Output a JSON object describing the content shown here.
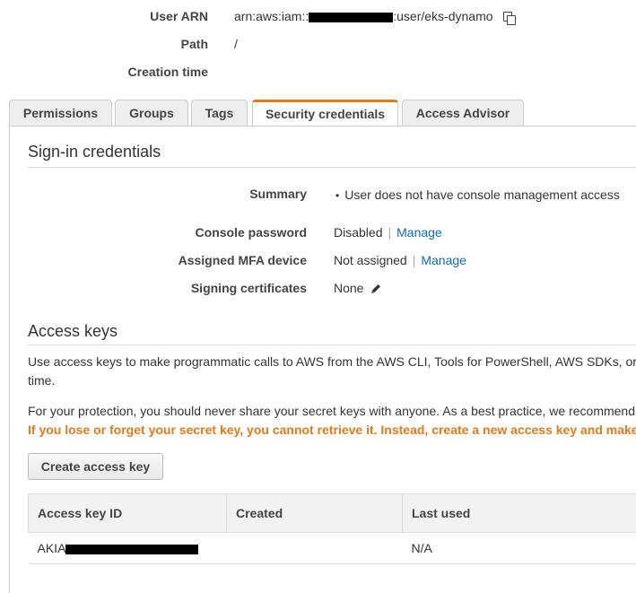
{
  "details": {
    "user_arn_label": "User ARN",
    "user_arn_prefix": "arn:aws:iam::",
    "user_arn_suffix": ":user/eks-dynamo",
    "path_label": "Path",
    "path_value": "/",
    "creation_time_label": "Creation time"
  },
  "tabs": [
    {
      "label": "Permissions"
    },
    {
      "label": "Groups"
    },
    {
      "label": "Tags"
    },
    {
      "label": "Security credentials"
    },
    {
      "label": "Access Advisor"
    }
  ],
  "signin": {
    "title": "Sign-in credentials",
    "summary_label": "Summary",
    "summary_value": "User does not have console management access",
    "console_password_label": "Console password",
    "console_password_value": "Disabled",
    "assigned_mfa_label": "Assigned MFA device",
    "assigned_mfa_value": "Not assigned",
    "signing_certs_label": "Signing certificates",
    "signing_certs_value": "None",
    "manage_label": "Manage",
    "separator": "|"
  },
  "access_keys": {
    "title": "Access keys",
    "desc_line1": "Use access keys to make programmatic calls to AWS from the AWS CLI, Tools for PowerShell, AWS SDKs, or",
    "desc_line2": "time.",
    "protection_text": "For your protection, you should never share your secret keys with anyone. As a best practice, we recommend",
    "warning_text": "If you lose or forget your secret key, you cannot retrieve it. Instead, create a new access key and make",
    "create_button": "Create access key",
    "columns": [
      "Access key ID",
      "Created",
      "Last used"
    ],
    "rows": [
      {
        "key_prefix": "AKIA",
        "created": "",
        "last_used": "N/A"
      }
    ]
  },
  "colors": {
    "accent": "#e07b1a",
    "link": "#0d6db4",
    "warning": "#e07b1a"
  }
}
